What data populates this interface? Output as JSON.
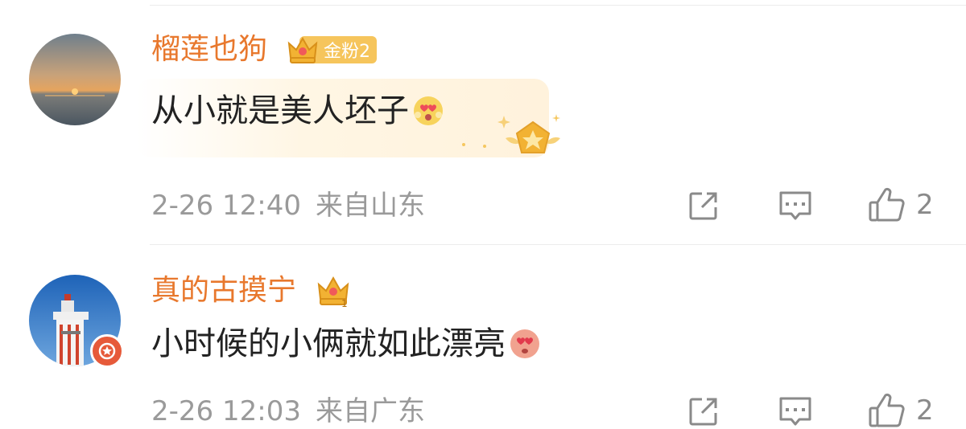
{
  "comments": [
    {
      "username": "榴莲也狗",
      "fan_badge": "金粉2",
      "text": "从小就是美人坯子",
      "time": "2-26 12:40",
      "location": "来自山东",
      "likes": "2",
      "emoji": "heart-eyes-emoji"
    },
    {
      "username": "真的古摸宁",
      "crown_level": "1",
      "text": "小时候的小俩就如此漂亮",
      "time": "2-26 12:03",
      "location": "来自广东",
      "likes": "2",
      "emoji": "heart-eyes-emoji"
    }
  ],
  "colors": {
    "username": "#e8782d",
    "meta": "#9a9a9a",
    "badge": "#f6c55c"
  }
}
